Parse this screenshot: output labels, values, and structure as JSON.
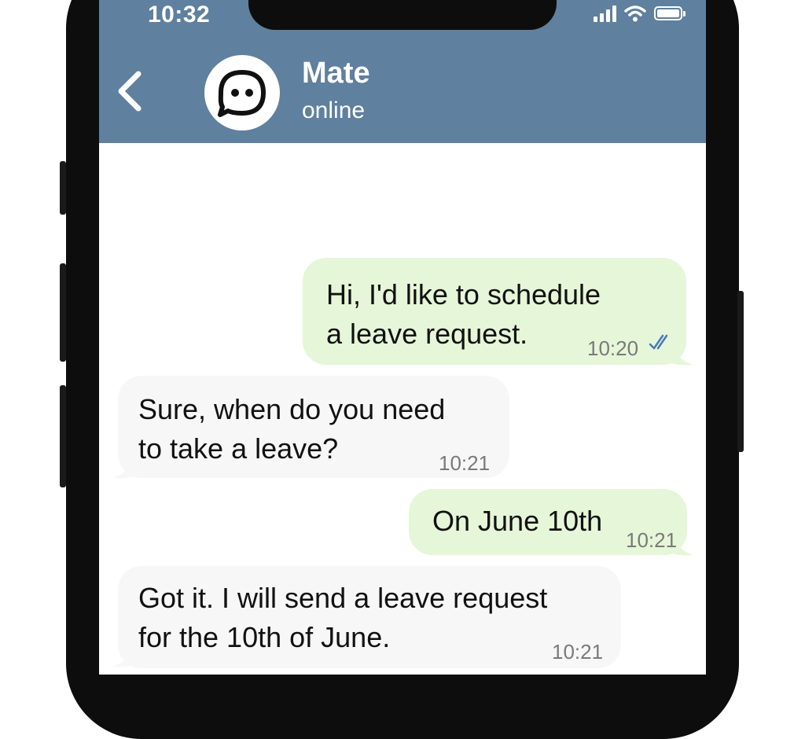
{
  "status_bar": {
    "time": "10:32"
  },
  "chat_header": {
    "contact_name": "Mate",
    "contact_status": "online",
    "avatar_icon": "chat-bubble-face-icon",
    "header_color": "#5f809e"
  },
  "messages": [
    {
      "direction": "outgoing",
      "lines": [
        "Hi, I'd like to schedule",
        "a leave request."
      ],
      "time": "10:20",
      "read_receipt": "double-check-icon"
    },
    {
      "direction": "incoming",
      "lines": [
        "Sure, when do you need",
        "to take a leave?"
      ],
      "time": "10:21"
    },
    {
      "direction": "outgoing",
      "lines": [
        "On June 10th"
      ],
      "time": "10:21"
    },
    {
      "direction": "incoming",
      "lines": [
        "Got it. I will send a leave request",
        "for the 10th of June."
      ],
      "time": "10:21"
    }
  ],
  "colors": {
    "outgoing_bubble": "#e6f6d8",
    "incoming_bubble": "#f7f7f7",
    "read_check": "#4a78b8"
  }
}
